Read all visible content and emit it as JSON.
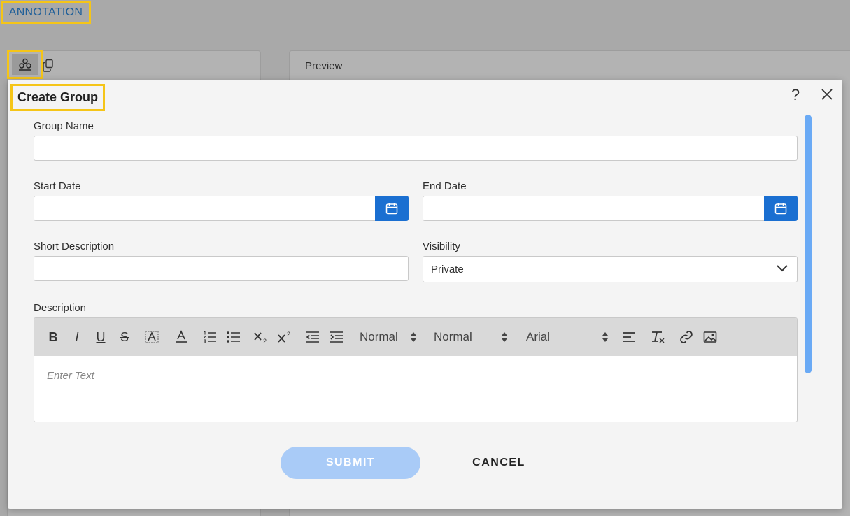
{
  "page": {
    "annotation_tab": "ANNOTATION",
    "preview_label": "Preview"
  },
  "dialog": {
    "title": "Create Group",
    "help_glyph": "?",
    "fields": {
      "group_name_label": "Group Name",
      "group_name_value": "",
      "start_date_label": "Start Date",
      "start_date_value": "",
      "end_date_label": "End Date",
      "end_date_value": "",
      "short_description_label": "Short Description",
      "short_description_value": "",
      "visibility_label": "Visibility",
      "visibility_value": "Private",
      "description_label": "Description"
    },
    "editor": {
      "placeholder": "Enter Text",
      "heading_select": "Normal",
      "size_select": "Normal",
      "font_select": "Arial",
      "bold": "B",
      "italic": "I",
      "underline": "U",
      "strike": "S"
    },
    "buttons": {
      "submit": "SUBMIT",
      "cancel": "CANCEL"
    }
  },
  "colors": {
    "highlight": "#f5c518",
    "accent": "#1a6fd1",
    "submit_disabled": "#a9cbf7"
  }
}
